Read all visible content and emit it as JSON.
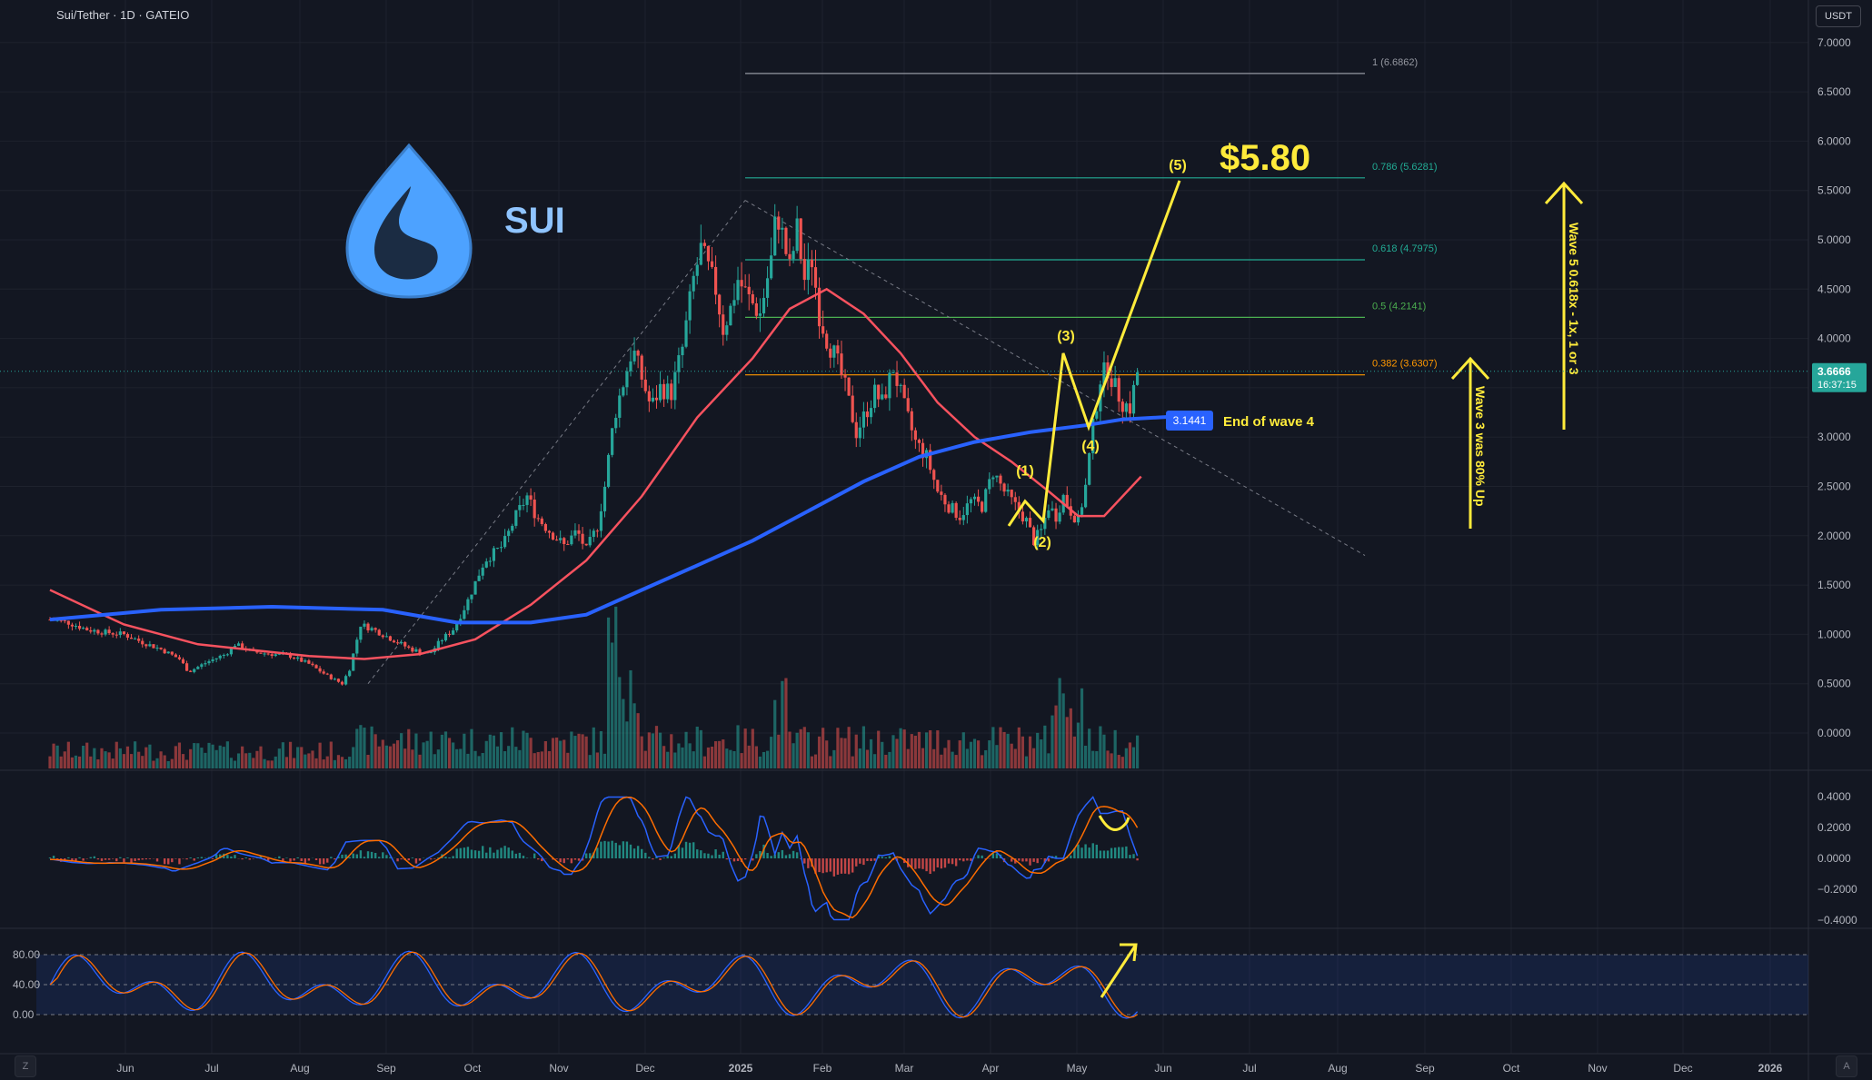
{
  "header": {
    "symbol_title": "Sui/Tether · 1D · GATEIO",
    "currency_button": "USDT"
  },
  "logo": {
    "text": "SUI"
  },
  "chart_data": {
    "type": "candlestick",
    "title": "Sui/Tether · 1D · GATEIO",
    "price_axis": {
      "min": 0,
      "max": 7,
      "step": 0.5,
      "ticks": [
        "0.0000",
        "0.5000",
        "1.0000",
        "1.5000",
        "2.0000",
        "2.5000",
        "3.0000",
        "3.5000",
        "4.0000",
        "4.5000",
        "5.0000",
        "5.5000",
        "6.0000",
        "6.5000",
        "7.0000"
      ]
    },
    "time_axis": {
      "labels": [
        "Jun",
        "Jul",
        "Aug",
        "Sep",
        "Oct",
        "Nov",
        "Dec",
        "2025",
        "Feb",
        "Mar",
        "Apr",
        "May",
        "Jun",
        "Jul",
        "Aug",
        "Sep",
        "Oct",
        "Nov",
        "Dec",
        "2026"
      ]
    },
    "last_price": {
      "value": "3.6666",
      "countdown": "16:37:15"
    },
    "price_series": {
      "name": "SUI/USDT close",
      "points": [
        [
          0,
          1.15
        ],
        [
          10,
          1.12
        ],
        [
          20,
          1.05
        ],
        [
          30,
          1.02
        ],
        [
          40,
          1.0
        ],
        [
          50,
          0.92
        ],
        [
          60,
          0.85
        ],
        [
          70,
          0.75
        ],
        [
          75,
          0.62
        ],
        [
          85,
          0.72
        ],
        [
          95,
          0.8
        ],
        [
          100,
          0.9
        ],
        [
          110,
          0.82
        ],
        [
          120,
          0.8
        ],
        [
          130,
          0.78
        ],
        [
          140,
          0.7
        ],
        [
          150,
          0.58
        ],
        [
          158,
          0.5
        ],
        [
          162,
          0.65
        ],
        [
          168,
          1.1
        ],
        [
          175,
          1.05
        ],
        [
          185,
          0.95
        ],
        [
          195,
          0.85
        ],
        [
          205,
          0.8
        ],
        [
          212,
          0.95
        ],
        [
          218,
          1.05
        ],
        [
          225,
          1.3
        ],
        [
          235,
          1.75
        ],
        [
          245,
          1.9
        ],
        [
          252,
          2.2
        ],
        [
          258,
          2.4
        ],
        [
          263,
          2.2
        ],
        [
          270,
          2.05
        ],
        [
          278,
          1.9
        ],
        [
          285,
          2.05
        ],
        [
          290,
          1.85
        ],
        [
          296,
          2.1
        ],
        [
          300,
          2.5
        ],
        [
          305,
          3.2
        ],
        [
          310,
          3.55
        ],
        [
          315,
          3.9
        ],
        [
          320,
          3.6
        ],
        [
          325,
          3.3
        ],
        [
          330,
          3.5
        ],
        [
          336,
          3.45
        ],
        [
          342,
          3.9
        ],
        [
          348,
          4.6
        ],
        [
          352,
          4.9
        ],
        [
          356,
          4.7
        ],
        [
          360,
          4.5
        ],
        [
          364,
          4.1
        ],
        [
          368,
          4.3
        ],
        [
          372,
          4.6
        ],
        [
          378,
          4.4
        ],
        [
          384,
          4.25
        ],
        [
          390,
          4.8
        ],
        [
          393,
          5.3
        ],
        [
          396,
          5.05
        ],
        [
          400,
          4.7
        ],
        [
          404,
          5.1
        ],
        [
          408,
          4.6
        ],
        [
          412,
          4.8
        ],
        [
          416,
          4.25
        ],
        [
          420,
          4.0
        ],
        [
          425,
          3.8
        ],
        [
          430,
          3.5
        ],
        [
          436,
          3.05
        ],
        [
          440,
          3.2
        ],
        [
          446,
          3.45
        ],
        [
          450,
          3.35
        ],
        [
          456,
          3.7
        ],
        [
          462,
          3.3
        ],
        [
          468,
          2.95
        ],
        [
          474,
          2.8
        ],
        [
          480,
          2.45
        ],
        [
          486,
          2.3
        ],
        [
          492,
          2.2
        ],
        [
          498,
          2.35
        ],
        [
          504,
          2.3
        ],
        [
          510,
          2.65
        ],
        [
          516,
          2.45
        ],
        [
          522,
          2.3
        ],
        [
          528,
          2.15
        ],
        [
          532,
          1.95
        ],
        [
          536,
          2.05
        ],
        [
          540,
          2.3
        ],
        [
          544,
          2.2
        ],
        [
          548,
          2.4
        ],
        [
          552,
          2.25
        ],
        [
          556,
          2.15
        ],
        [
          560,
          2.5
        ],
        [
          564,
          3.1
        ],
        [
          568,
          3.6
        ],
        [
          572,
          3.7
        ],
        [
          576,
          3.5
        ],
        [
          580,
          3.35
        ],
        [
          584,
          3.3
        ],
        [
          588,
          3.66
        ]
      ]
    },
    "moving_averages": [
      {
        "name": "",
        "color": "#f7525f",
        "points": [
          [
            0,
            1.45
          ],
          [
            40,
            1.1
          ],
          [
            80,
            0.9
          ],
          [
            140,
            0.78
          ],
          [
            170,
            0.75
          ],
          [
            200,
            0.8
          ],
          [
            230,
            0.95
          ],
          [
            260,
            1.3
          ],
          [
            290,
            1.75
          ],
          [
            320,
            2.4
          ],
          [
            350,
            3.2
          ],
          [
            380,
            3.8
          ],
          [
            400,
            4.3
          ],
          [
            420,
            4.5
          ],
          [
            440,
            4.25
          ],
          [
            460,
            3.85
          ],
          [
            480,
            3.35
          ],
          [
            500,
            3.0
          ],
          [
            520,
            2.75
          ],
          [
            540,
            2.45
          ],
          [
            556,
            2.2
          ],
          [
            570,
            2.2
          ],
          [
            590,
            2.6
          ]
        ]
      },
      {
        "name": "",
        "color": "#2962ff",
        "points": [
          [
            0,
            1.15
          ],
          [
            60,
            1.25
          ],
          [
            120,
            1.28
          ],
          [
            180,
            1.25
          ],
          [
            220,
            1.12
          ],
          [
            260,
            1.12
          ],
          [
            290,
            1.2
          ],
          [
            320,
            1.45
          ],
          [
            350,
            1.7
          ],
          [
            380,
            1.95
          ],
          [
            410,
            2.25
          ],
          [
            440,
            2.55
          ],
          [
            470,
            2.8
          ],
          [
            500,
            2.95
          ],
          [
            530,
            3.05
          ],
          [
            560,
            3.12
          ],
          [
            580,
            3.18
          ],
          [
            600,
            3.2
          ],
          [
            620,
            3.22
          ]
        ]
      }
    ],
    "fibonacci_levels": [
      {
        "ratio": "1",
        "price": 6.6862,
        "label": "1 (6.6862)",
        "color": "#9598a1"
      },
      {
        "ratio": "0.786",
        "price": 5.6281,
        "label": "0.786 (5.6281)",
        "color": "#22ab94"
      },
      {
        "ratio": "0.618",
        "price": 4.7975,
        "label": "0.618 (4.7975)",
        "color": "#22ab94"
      },
      {
        "ratio": "0.5",
        "price": 4.2141,
        "label": "0.5 (4.2141)",
        "color": "#4caf50"
      },
      {
        "ratio": "0.382",
        "price": 3.6307,
        "label": "0.382 (3.6307)",
        "color": "#ff9800"
      }
    ],
    "elliott_waves": [
      {
        "label": "(1)",
        "price": 2.4
      },
      {
        "label": "(2)",
        "price": 2.1
      },
      {
        "label": "(3)",
        "price": 3.85
      },
      {
        "label": "(4)",
        "price": 3.1441
      },
      {
        "label": "(5)",
        "price": 5.6
      }
    ],
    "annotations": {
      "target_price": "$5.80",
      "wave4_price": "3.1441",
      "wave4_text": "End of wave 4",
      "wave3_note": "Wave 3 was 80% Up",
      "wave5_note": "Wave 5 0.618x - 1x, 1 or 3"
    },
    "macd_axis": {
      "ticks": [
        "0.4000",
        "0.2000",
        "0.0000",
        "−0.2000",
        "−0.4000"
      ]
    },
    "stoch_axis": {
      "ticks": [
        "80.00",
        "40.00",
        "0.00"
      ]
    }
  },
  "colors": {
    "background": "#131722",
    "grid": "#1e222d",
    "up": "#26a69a",
    "down": "#ef5350",
    "annotation": "#ffeb3b",
    "logo": "#4da2ff"
  }
}
